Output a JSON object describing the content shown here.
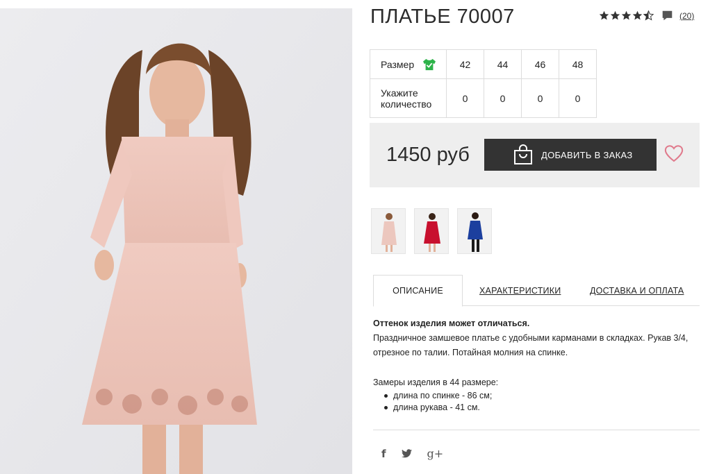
{
  "product": {
    "title": "ПЛАТЬЕ 70007",
    "rating": 4.5,
    "review_count": "(20)",
    "price": "1450 руб"
  },
  "sizes": {
    "header_label": "Размер",
    "quantity_label_1": "Укажите",
    "quantity_label_2": "количество",
    "items": [
      {
        "size": "42",
        "qty": "0"
      },
      {
        "size": "44",
        "qty": "0"
      },
      {
        "size": "46",
        "qty": "0"
      },
      {
        "size": "48",
        "qty": "0"
      }
    ]
  },
  "buy": {
    "add_to_order_label": "ДОБАВИТЬ В ЗАКАЗ"
  },
  "thumbnails": [
    {
      "color": "pink",
      "dress_color": "#ecc7be"
    },
    {
      "color": "red",
      "dress_color": "#c8102e"
    },
    {
      "color": "blue",
      "dress_color": "#1c3f9e"
    }
  ],
  "tabs": [
    {
      "label": "ОПИСАНИЕ",
      "active": true
    },
    {
      "label": "ХАРАКТЕРИСТИКИ",
      "active": false
    },
    {
      "label": "ДОСТАВКА И ОПЛАТА",
      "active": false
    }
  ],
  "description": {
    "note": "Оттенок изделия может отличаться.",
    "text": "Праздничное замшевое платье с удобными карманами в складках. Рукав 3/4, отрезное по талии. Потайная молния на спинке.",
    "measure_title": "Замеры изделия в 44 размере:",
    "measures": [
      "длина по спинке - 86 см;",
      "длина рукава - 41 см."
    ]
  },
  "social": {
    "facebook": "f",
    "google": "g+"
  },
  "colors": {
    "accent_green": "#2db34a",
    "heart_pink": "#e07a8c",
    "button_dark": "#333333"
  }
}
